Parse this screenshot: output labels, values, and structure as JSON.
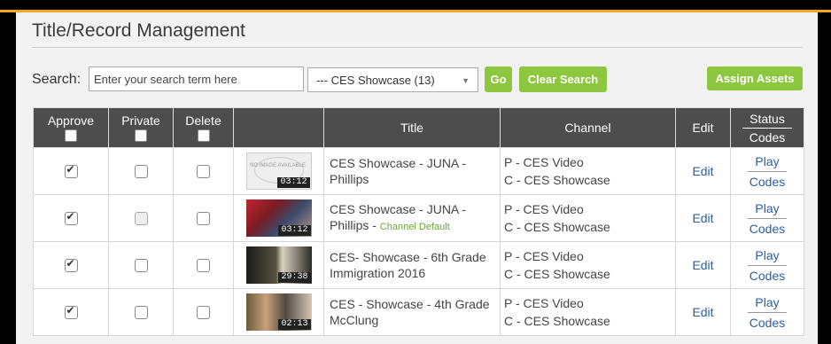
{
  "page_title": "Title/Record Management",
  "search": {
    "label": "Search:",
    "placeholder": "Enter your search term here",
    "value": ""
  },
  "channel_filter": {
    "selected": "--- CES Showcase (13)"
  },
  "buttons": {
    "go": "Go",
    "clear_search": "Clear Search",
    "assign_assets": "Assign Assets"
  },
  "colors": {
    "accent_green": "#8dc63f",
    "header_bg": "#4d4d4d",
    "top_border": "#f0a81e",
    "link": "#2a5fa0"
  },
  "table": {
    "headers": {
      "approve": "Approve",
      "private": "Private",
      "delete": "Delete",
      "title": "Title",
      "channel": "Channel",
      "edit": "Edit",
      "status": "Status",
      "codes": "Codes"
    },
    "rows": [
      {
        "approve": true,
        "private": false,
        "private_disabled": false,
        "delete": false,
        "thumb": "no-image",
        "thumb_text": "NO IMAGE AVAILABLE",
        "duration": "03:12",
        "title": "CES Showcase - JUNA - Phillips",
        "channel_default": "",
        "channel_p": "P - CES Video",
        "channel_c": "C - CES Showcase",
        "edit": "Edit",
        "play": "Play",
        "codes": "Codes"
      },
      {
        "approve": true,
        "private": false,
        "private_disabled": true,
        "delete": false,
        "thumb": "video",
        "thumb_text": "",
        "duration": "03:12",
        "title": "CES Showcase - JUNA - Phillips - ",
        "channel_default": "Channel Default",
        "channel_p": "P - CES Video",
        "channel_c": "C - CES Showcase",
        "edit": "Edit",
        "play": "Play",
        "codes": "Codes"
      },
      {
        "approve": true,
        "private": false,
        "private_disabled": false,
        "delete": false,
        "thumb": "video",
        "thumb_text": "",
        "duration": "29:38",
        "title": "CES- Showcase - 6th Grade Immigration 2016",
        "channel_default": "",
        "channel_p": "P - CES Video",
        "channel_c": "C - CES Showcase",
        "edit": "Edit",
        "play": "Play",
        "codes": "Codes"
      },
      {
        "approve": true,
        "private": false,
        "private_disabled": false,
        "delete": false,
        "thumb": "video",
        "thumb_text": "",
        "duration": "02:13",
        "title": "CES - Showcase - 4th Grade McClung",
        "channel_default": "",
        "channel_p": "P - CES Video",
        "channel_c": "C - CES Showcase",
        "edit": "Edit",
        "play": "Play",
        "codes": "Codes"
      }
    ]
  }
}
